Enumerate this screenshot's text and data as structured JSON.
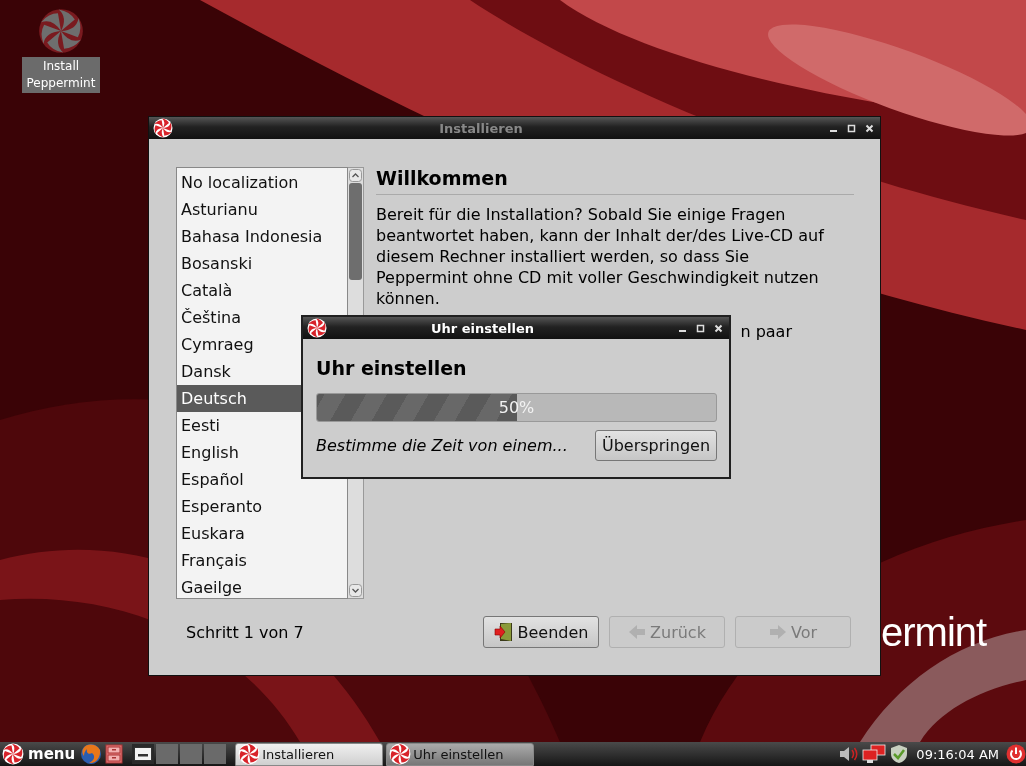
{
  "desktop": {
    "icons": [
      {
        "label": "Install Peppermint",
        "selected": true
      }
    ],
    "wallpaper_logo": "ermint"
  },
  "installer": {
    "title": "Installieren",
    "languages": [
      {
        "label": "No localization",
        "selected": false
      },
      {
        "label": "Asturianu",
        "selected": false
      },
      {
        "label": "Bahasa Indonesia",
        "selected": false
      },
      {
        "label": "Bosanski",
        "selected": false
      },
      {
        "label": "Català",
        "selected": false
      },
      {
        "label": "Čeština",
        "selected": false
      },
      {
        "label": "Cymraeg",
        "selected": false
      },
      {
        "label": "Dansk",
        "selected": false
      },
      {
        "label": "Deutsch",
        "selected": true
      },
      {
        "label": "Eesti",
        "selected": false
      },
      {
        "label": "English",
        "selected": false
      },
      {
        "label": "Español",
        "selected": false
      },
      {
        "label": "Esperanto",
        "selected": false
      },
      {
        "label": "Euskara",
        "selected": false
      },
      {
        "label": "Français",
        "selected": false
      },
      {
        "label": "Gaeilge",
        "selected": false
      }
    ],
    "heading": "Willkommen",
    "intro": "Bereit für die Installation? Sobald Sie einige Fragen beantwortet haben, kann der Inhalt der/des Live-CD auf diesem Rechner installiert werden, so dass Sie Peppermint ohne CD mit voller Geschwindigkeit nutzen können.",
    "partial_text": "n paar",
    "step": "Schritt 1 von 7",
    "buttons": [
      {
        "label": "Beenden",
        "kind": "quit",
        "disabled": false
      },
      {
        "label": "Zurück",
        "kind": "back",
        "disabled": true
      },
      {
        "label": "Vor",
        "kind": "forward",
        "disabled": true
      }
    ]
  },
  "dialog": {
    "title": "Uhr einstellen",
    "heading": "Uhr einstellen",
    "progress": {
      "level": 0.5,
      "reading": "50%"
    },
    "status": "Bestimme die Zeit von einem...",
    "button": "Überspringen"
  },
  "taskbar": {
    "menu": "menu",
    "workspaces": [
      {
        "selected": true
      },
      {
        "selected": false
      },
      {
        "selected": false
      },
      {
        "selected": false
      }
    ],
    "tasks": [
      {
        "label": "Installieren",
        "selected": true
      },
      {
        "label": "Uhr einstellen",
        "selected": false
      }
    ],
    "clock": "09:16:04 AM"
  }
}
